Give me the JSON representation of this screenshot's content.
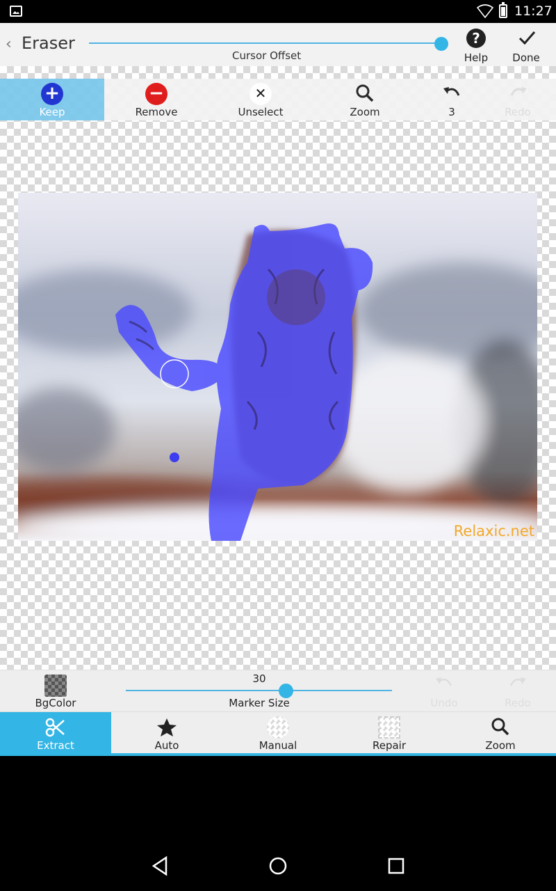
{
  "status_bar": {
    "time": "11:27",
    "icons": [
      "gallery-icon",
      "wifi-icon",
      "battery-icon"
    ]
  },
  "header": {
    "back_icon": "chevron-left-icon",
    "title": "Eraser",
    "slider_label": "Cursor Offset",
    "help_label": "Help",
    "done_label": "Done"
  },
  "toolbar": {
    "keep": "Keep",
    "remove": "Remove",
    "unselect": "Unselect",
    "zoom": "Zoom",
    "undo_count": "3",
    "redo": "Redo"
  },
  "canvas": {
    "watermark": "Relaxic.net",
    "selection_color": "#4a4aff"
  },
  "bottom_controls": {
    "bgcolor_label": "BgColor",
    "marker_size_value": "30",
    "marker_size_label": "Marker Size",
    "undo_label": "Undo",
    "redo_label": "Redo"
  },
  "mode_tabs": {
    "extract": "Extract",
    "auto": "Auto",
    "manual": "Manual",
    "repair": "Repair",
    "zoom": "Zoom"
  },
  "colors": {
    "accent": "#33b5e5",
    "keep_blue": "#1a2fd0",
    "remove_red": "#e01515",
    "highlight": "#7ec9ec"
  }
}
